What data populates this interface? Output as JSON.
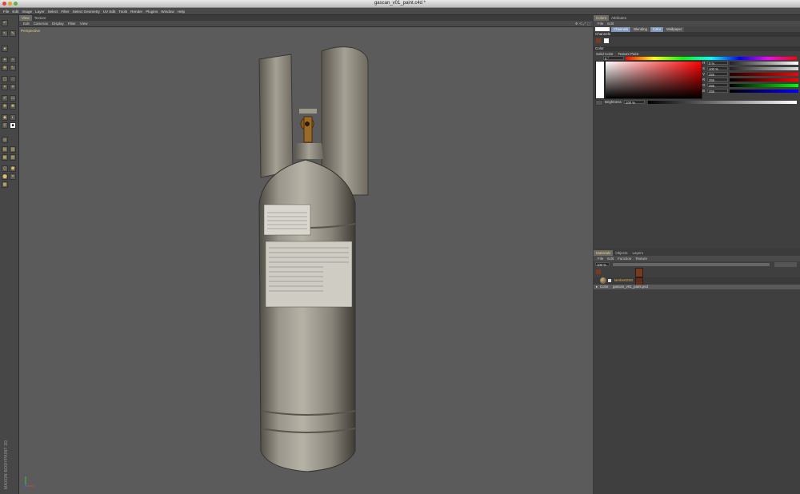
{
  "window": {
    "title": "gascan_v01_paint.c4d *"
  },
  "menu": [
    "File",
    "Edit",
    "Image",
    "Layer",
    "Select",
    "Filter",
    "Select Geometry",
    "UV Edit",
    "Tools",
    "Render",
    "Plugins",
    "Window",
    "Help"
  ],
  "viewport": {
    "tabs": [
      "View",
      "Texture"
    ],
    "menu": [
      "Edit",
      "Cameras",
      "Display",
      "Filter",
      "View"
    ],
    "label": "Perspective"
  },
  "colors_panel": {
    "tabs": [
      "Colors",
      "Attributes"
    ],
    "menu": [
      "File",
      "Edit"
    ],
    "buttons": [
      "Channels",
      "Blending",
      "Color",
      "Wallpaper"
    ],
    "active_button": "Color",
    "channels_label": "Channels",
    "color_label": "Color",
    "solid_color": "Solid Color",
    "texture_paint": "Texture Paint",
    "hue_value": "0 °",
    "rows": [
      {
        "label": "H",
        "value": "0 %"
      },
      {
        "label": "S",
        "value": "100 %"
      },
      {
        "label": "V",
        "value": "255"
      },
      {
        "label": "R",
        "value": "255"
      },
      {
        "label": "G",
        "value": "255"
      },
      {
        "label": "B",
        "value": "255"
      }
    ],
    "brightness_label": "Brightness",
    "brightness_value": "100 %"
  },
  "materials_panel": {
    "tabs": [
      "Materials",
      "Objects",
      "Layers"
    ],
    "menu": [
      "File",
      "Edit",
      "Function",
      "Texture"
    ],
    "zoom": "100 %",
    "material_name": "lambert2SG",
    "channel": "Color",
    "file": "gascan_v01_paint.psd"
  },
  "watermark": "MAXON BODYPAINT 3D",
  "colors": {
    "accent": "#e0b84a",
    "panel": "#3f3f3f",
    "viewport": "#5b5b5b",
    "select_blue": "#7c96b8"
  }
}
